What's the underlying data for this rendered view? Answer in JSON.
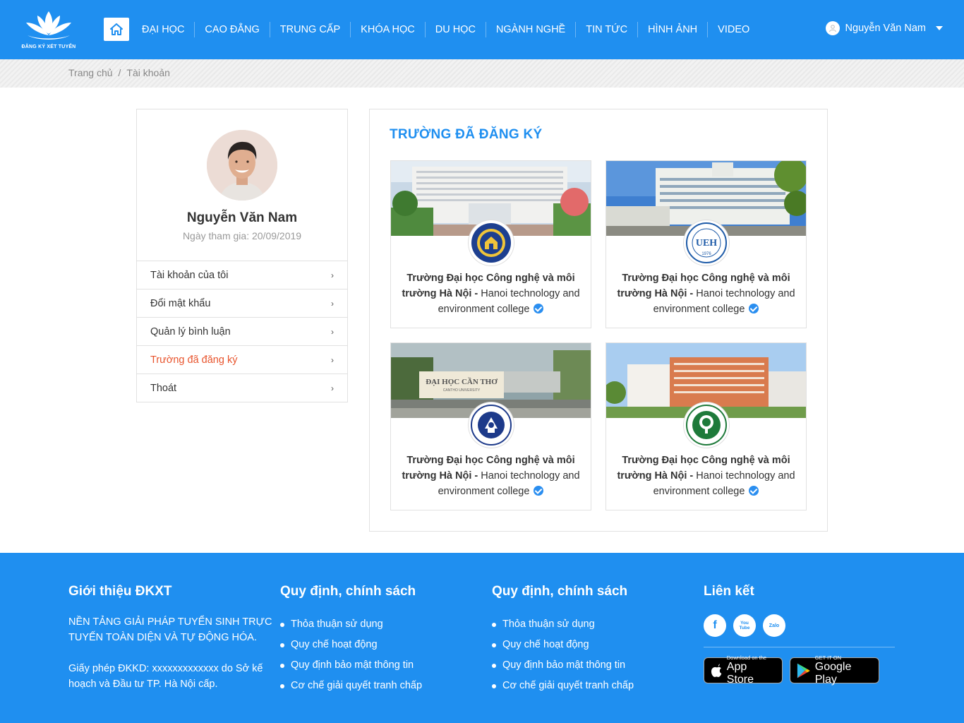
{
  "header": {
    "logo_text": "ĐĂNG KÝ XÉT TUYỂN",
    "nav": [
      "ĐẠI HỌC",
      "CAO ĐẲNG",
      "TRUNG CẤP",
      "KHÓA HỌC",
      "DU HỌC",
      "NGÀNH NGHỀ",
      "TIN TỨC",
      "HÌNH ẢNH",
      "VIDEO"
    ],
    "user_name": "Nguyễn Văn Nam"
  },
  "breadcrumb": {
    "home": "Trang chủ",
    "separator": "/",
    "current": "Tài khoản"
  },
  "profile": {
    "name": "Nguyễn Văn Nam",
    "join_date": "Ngày tham gia: 20/09/2019"
  },
  "side_menu": [
    {
      "label": "Tài khoản của tôi",
      "active": false
    },
    {
      "label": "Đổi mật khẩu",
      "active": false
    },
    {
      "label": "Quản lý bình luận",
      "active": false
    },
    {
      "label": "Trường đã đăng ký",
      "active": true
    },
    {
      "label": "Thoát",
      "active": false
    }
  ],
  "main": {
    "title": "TRƯỜNG ĐÃ ĐĂNG KÝ",
    "schools": [
      {
        "name": "Trường Đại học Công nghệ và môi trường Hà Nội",
        "dash": " - ",
        "english": "Hanoi technology and environment college"
      },
      {
        "name": "Trường Đại học Công nghệ và môi trường Hà Nội",
        "dash": " - ",
        "english": "Hanoi technology and environment college"
      },
      {
        "name": "Trường Đại học Công nghệ và môi trường Hà Nội",
        "dash": " - ",
        "english": "Hanoi technology and environment college"
      },
      {
        "name": "Trường Đại học Công nghệ và môi trường Hà Nội",
        "dash": " - ",
        "english": "Hanoi technology and environment college"
      }
    ],
    "school_photo_text_3": "ĐẠI HỌC CẦN THƠ",
    "school_photo_subtext_3": "CANTHO UNIVERSITY",
    "school_logo_year_2": "1976",
    "school_logo_text_2": "UEH"
  },
  "footer": {
    "col1": {
      "title": "Giới thiệu ĐKXT",
      "text1": "NỀN TẢNG GIẢI PHÁP TUYỂN SINH TRỰC TUYẾN TOÀN DIỆN VÀ TỰ ĐỘNG HÓA.",
      "text2": "Giấy phép ĐKKD: xxxxxxxxxxxxx do Sở kế hoạch và Đầu tư TP. Hà Nội cấp."
    },
    "col2": {
      "title": "Quy định, chính sách",
      "items": [
        "Thỏa thuận sử dụng",
        "Quy chế hoạt động",
        "Quy định bảo mật thông tin",
        "Cơ chế giải quyết tranh chấp"
      ]
    },
    "col3": {
      "title": "Quy định, chính sách",
      "items": [
        "Thỏa thuận sử dụng",
        "Quy chế hoạt động",
        "Quy định bảo mật thông tin",
        "Cơ chế giải quyết tranh chấp"
      ]
    },
    "col4": {
      "title": "Liên kết",
      "social": [
        "f",
        "You Tube",
        "Zalo"
      ],
      "app_store_small": "Download on the",
      "app_store_big": "App Store",
      "google_small": "GET IT ON",
      "google_big": "Google Play"
    }
  },
  "colors": {
    "primary": "#1f8ff0",
    "active_menu": "#e8542d"
  },
  "icons": {
    "home": "home-icon",
    "user": "user-icon",
    "caret": "caret-down-icon",
    "chevron": "chevron-right-icon",
    "verified": "verified-check-icon"
  }
}
